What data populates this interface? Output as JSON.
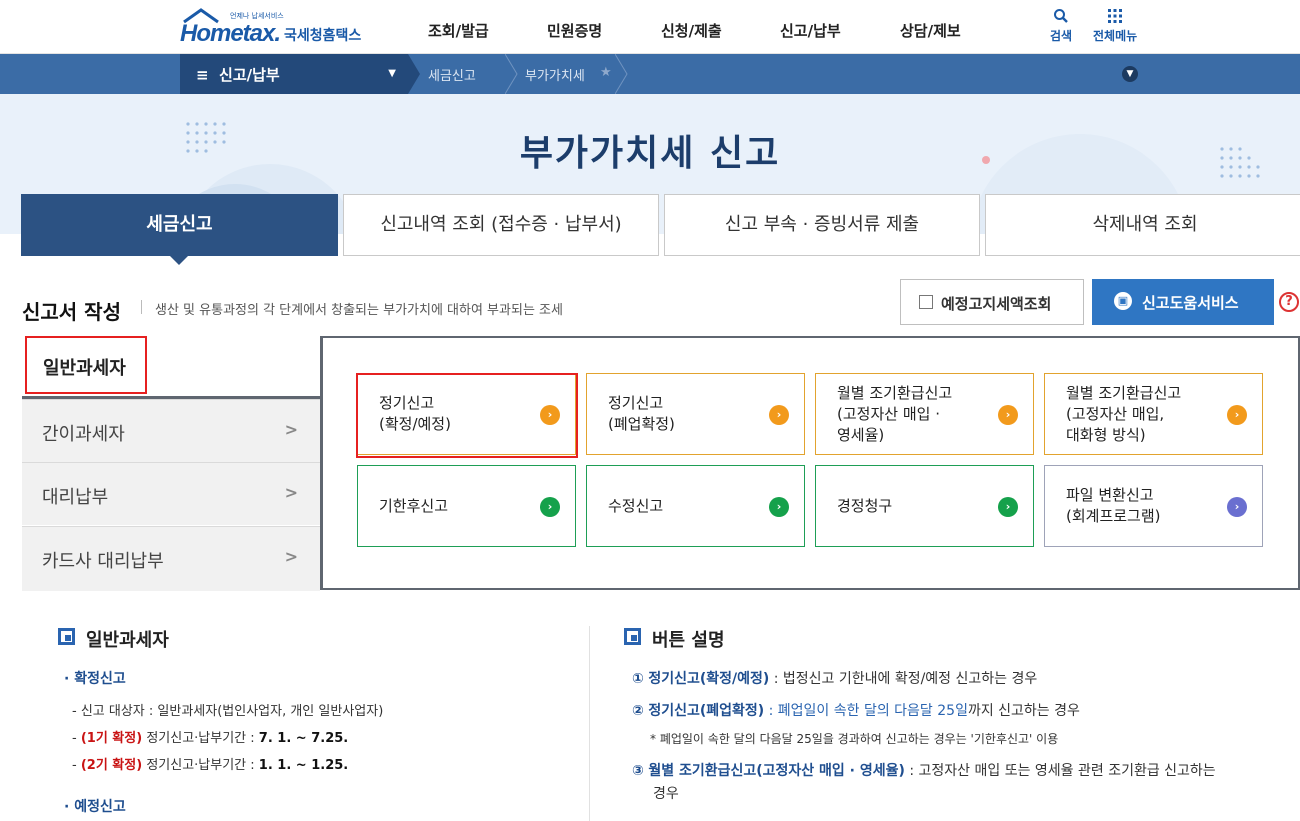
{
  "header": {
    "logo_text": "Hometax.",
    "logo_sub": "언제나 납세서비스",
    "logo_kr": "국세청홈택스",
    "menu": [
      "조회/발급",
      "민원증명",
      "신청/제출",
      "신고/납부",
      "상담/제보"
    ],
    "search_label": "검색",
    "allmenu_label": "전체메뉴"
  },
  "breadcrumb": {
    "first": "신고/납부",
    "items": [
      "세금신고",
      "부가가치세"
    ]
  },
  "hero": {
    "title": "부가가치세 신고"
  },
  "tabs": [
    {
      "label": "세금신고",
      "active": true
    },
    {
      "label": "신고내역 조회 (접수증 · 납부서)",
      "active": false
    },
    {
      "label": "신고 부속 · 증빙서류 제출",
      "active": false
    },
    {
      "label": "삭제내역 조회",
      "active": false
    }
  ],
  "section": {
    "title": "신고서 작성",
    "desc": "생산 및 유통과정의 각 단계에서 창출되는 부가가치에 대하여 부과되는 조세",
    "btn_preview": "예정고지세액조회",
    "btn_help": "신고도움서비스",
    "help_icon": "?"
  },
  "side": {
    "active": "일반과세자",
    "items": [
      "간이과세자",
      "대리납부",
      "카드사 대리납부"
    ]
  },
  "cards": [
    {
      "line1": "정기신고",
      "line2": "(확정/예정)",
      "line3": "",
      "color": "orange"
    },
    {
      "line1": "정기신고",
      "line2": "(폐업확정)",
      "line3": "",
      "color": "orange"
    },
    {
      "line1": "월별 조기환급신고",
      "line2": "(고정자산 매입 ·",
      "line3": "영세율)",
      "color": "orange"
    },
    {
      "line1": "월별 조기환급신고",
      "line2": "(고정자산 매입,",
      "line3": "대화형 방식)",
      "color": "orange"
    },
    {
      "line1": "기한후신고",
      "line2": "",
      "line3": "",
      "color": "green"
    },
    {
      "line1": "수정신고",
      "line2": "",
      "line3": "",
      "color": "green"
    },
    {
      "line1": "경정청구",
      "line2": "",
      "line3": "",
      "color": "green"
    },
    {
      "line1": "파일 변환신고",
      "line2": "(회계프로그램)",
      "line3": "",
      "color": "purple"
    }
  ],
  "left_info": {
    "title": "일반과세자",
    "h1": "확정신고",
    "target_label": "신고 대상자 : 일반과세자(법인사업자, 개인 일반사업자)",
    "p1_tag": "(1기 확정)",
    "p1_text": "정기신고·납부기간 : ",
    "p1_date": "7. 1. ~ 7.25.",
    "p2_tag": "(2기 확정)",
    "p2_text": "정기신고·납부기간 : ",
    "p2_date": "1. 1. ~ 1.25.",
    "h2": "예정신고"
  },
  "right_info": {
    "title": "버튼 설명",
    "r1_num": "①",
    "r1_key": "정기신고(확정/예정)",
    "r1_text": " : 법정신고 기한내에 확정/예정 신고하는 경우",
    "r2_num": "②",
    "r2_key": "정기신고(폐업확정)",
    "r2_mid": " : 폐업일이 속한 달의 다음달 25일",
    "r2_end": "까지 신고하는 경우",
    "r2_note": "* 폐업일이 속한 달의 다음달 25일을 경과하여 신고하는 경우는 '기한후신고' 이용",
    "r3_num": "③",
    "r3_key": "월별 조기환급신고(고정자산 매입 · 영세율)",
    "r3_text": " : 고정자산 매입 또는 영세율 관련 조기환급 신고하는",
    "r3_wrap": "경우"
  }
}
